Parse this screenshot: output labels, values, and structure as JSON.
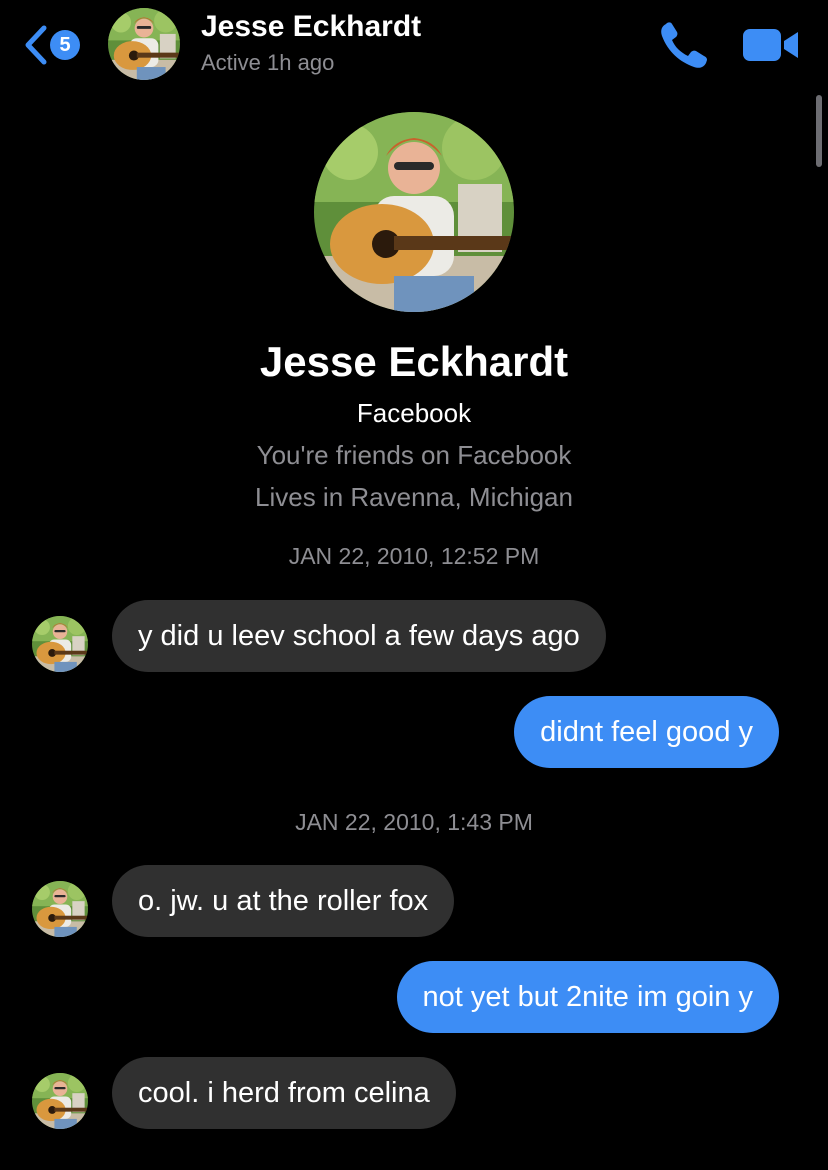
{
  "colors": {
    "background": "#000000",
    "accent": "#3d8df5",
    "incoming_bubble": "#303030",
    "secondary_text": "#8e8e93"
  },
  "header": {
    "back_badge_count": "5",
    "name": "Jesse Eckhardt",
    "status": "Active 1h ago",
    "icons": [
      "back-chevron-icon",
      "phone-icon",
      "video-camera-icon"
    ]
  },
  "profile": {
    "name": "Jesse Eckhardt",
    "source": "Facebook",
    "friends": "You're friends on Facebook",
    "location": "Lives in Ravenna, Michigan"
  },
  "conversation": {
    "timestamp_1": "JAN 22, 2010, 12:52 PM",
    "timestamp_2": "JAN 22, 2010, 1:43 PM",
    "messages": [
      {
        "direction": "incoming",
        "text": "y did u leev school a few days ago"
      },
      {
        "direction": "outgoing",
        "text": "didnt feel good y"
      },
      {
        "direction": "incoming",
        "text": "o. jw. u at the roller fox"
      },
      {
        "direction": "outgoing",
        "text": "not yet but 2nite im goin y"
      },
      {
        "direction": "incoming",
        "text": "cool. i herd from celina"
      }
    ]
  }
}
